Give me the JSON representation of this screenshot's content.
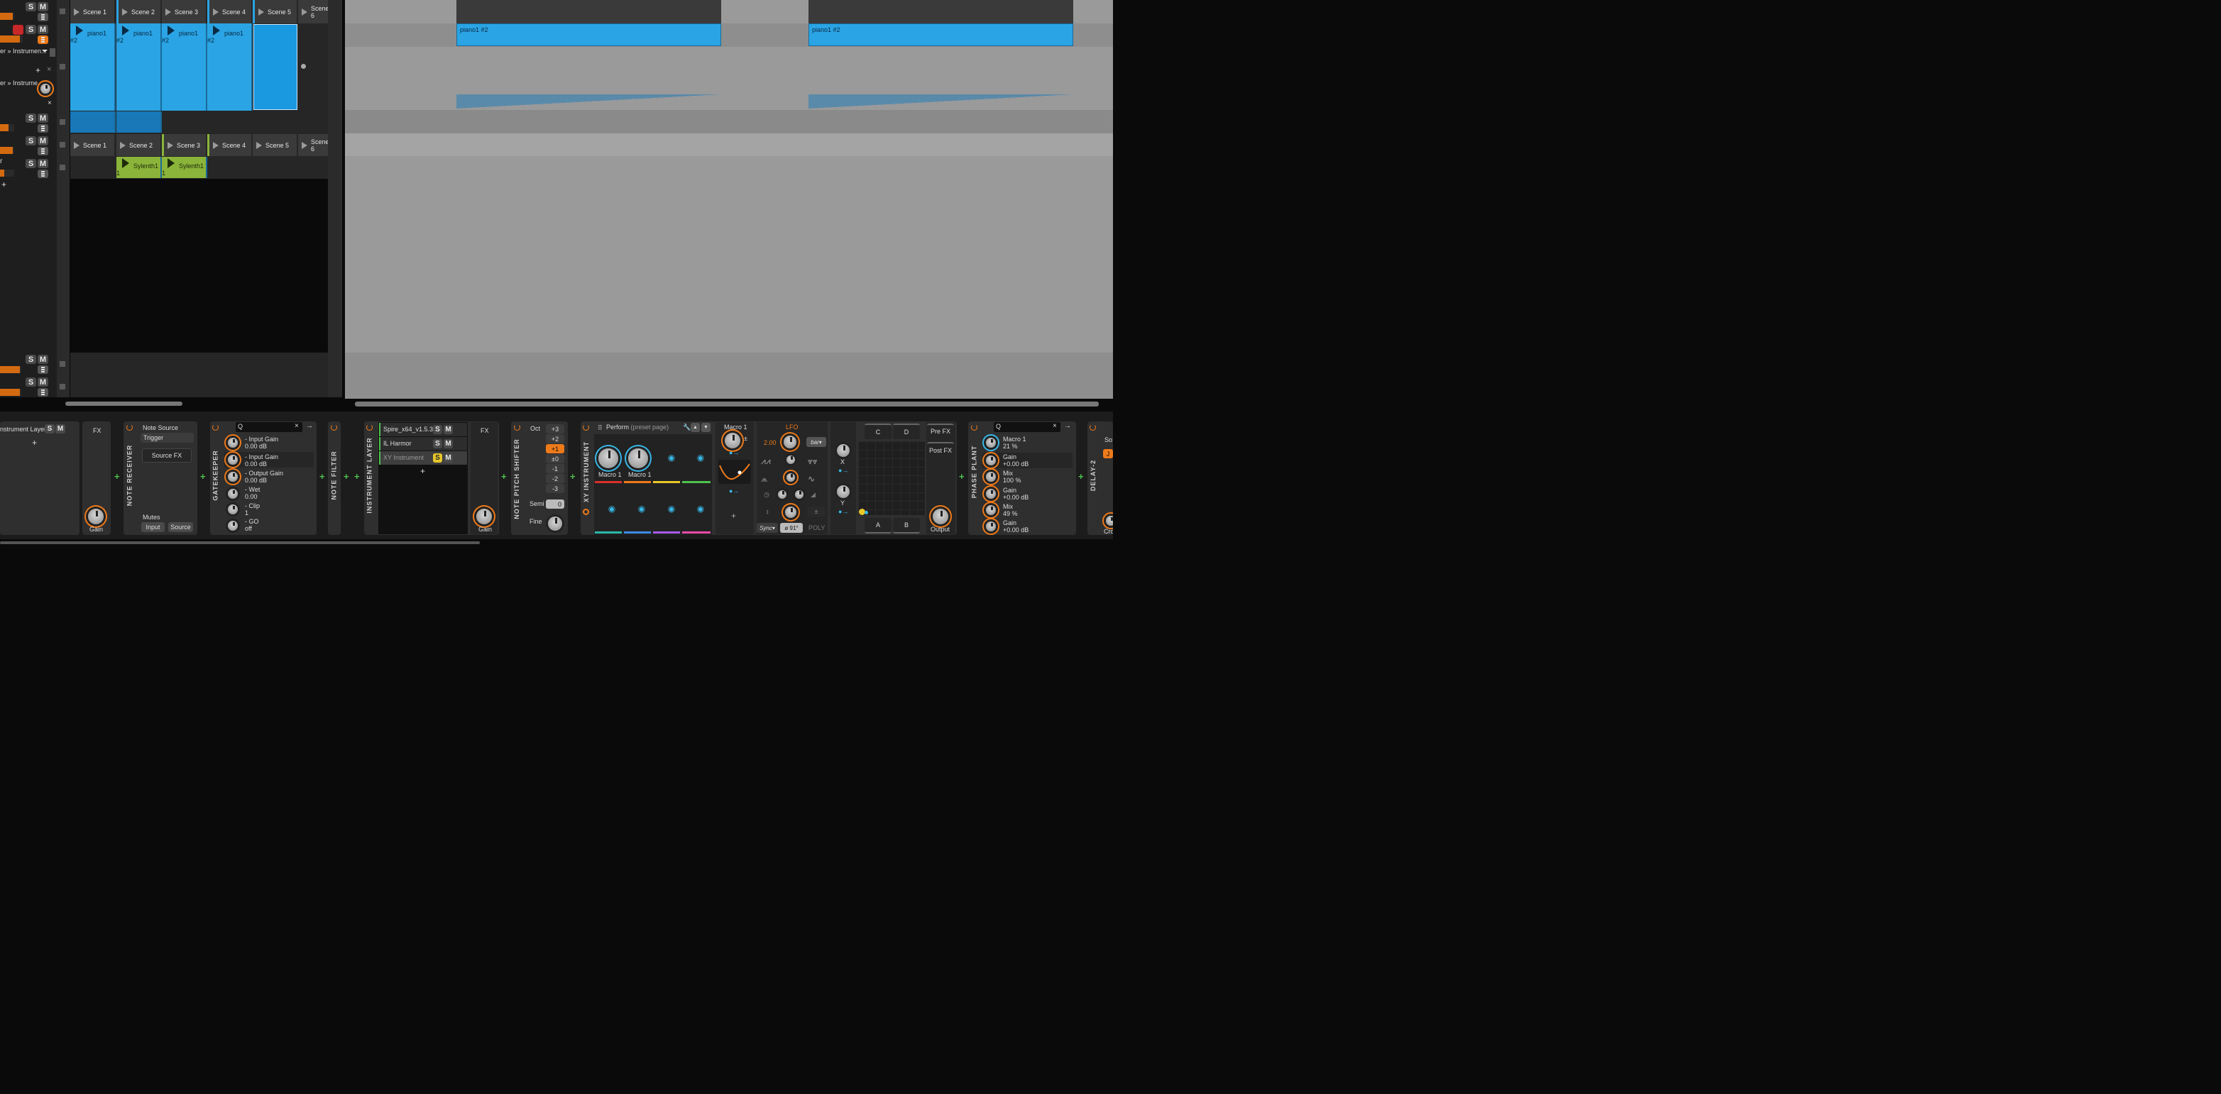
{
  "mixer": {
    "solo": "S",
    "mute": "M"
  },
  "tracks": [
    {
      "scenes": [
        "Scene 1",
        "Scene 2",
        "Scene 3",
        "Scene 4",
        "Scene 5",
        "Scene 6"
      ]
    },
    {
      "device_label_1": "er » Instrumen...",
      "device_label_2": "er » Instrume...",
      "clips": [
        "piano1 #2",
        "piano1 #2",
        "piano1 #2",
        "piano1 #2"
      ]
    },
    {
      "scenes2": [
        "Scene 1",
        "Scene 2",
        "Scene 3",
        "Scene 4",
        "Scene 5",
        "Scene 6"
      ]
    },
    {
      "clips": [
        "Sylenth1 1",
        "Sylenth1 1"
      ],
      "name": "r"
    }
  ],
  "arranger": {
    "clip_a": "piano1 #2",
    "clip_b": "piano1 #2"
  },
  "devices": {
    "instrument_layer_left": {
      "label": "nstrument Layer",
      "fx": "FX",
      "gain": "Gain"
    },
    "note_receiver": {
      "title": "NOTE RECEIVER",
      "note_source": "Note Source",
      "trigger": "Trigger",
      "source_fx": "Source FX",
      "mutes": "Mutes",
      "input": "Input",
      "source": "Source"
    },
    "gatekeeper": {
      "title": "GATEKEEPER",
      "params": [
        {
          "name": "- Input Gain",
          "value": "0.00 dB"
        },
        {
          "name": "- Input Gain",
          "value": "0.00 dB"
        },
        {
          "name": "- Output Gain",
          "value": "0.00 dB"
        },
        {
          "name": "- Wet",
          "value": "0.00"
        },
        {
          "name": "- Clip",
          "value": "1"
        },
        {
          "name": "- GO",
          "value": "off"
        }
      ]
    },
    "note_filter": {
      "title": "NOTE FILTER"
    },
    "instrument_layer": {
      "title": "INSTRUMENT LAYER",
      "layers": [
        "Spire_x64_v1.5.3",
        "IL Harmor",
        "XY Instrument"
      ],
      "fx": "FX",
      "gain": "Gain"
    },
    "note_pitch_shifter": {
      "title": "NOTE PITCH SHIFTER",
      "oct": "Oct",
      "values": [
        "+3",
        "+2",
        "+1",
        "±0",
        "-1",
        "-2",
        "-3"
      ],
      "semi": "Semi",
      "semi_value": "0",
      "fine": "Fine"
    },
    "xy_instrument": {
      "title": "XY INSTRUMENT",
      "perform": "Perform",
      "preset_page": "(preset page)",
      "macro": "Macro 1",
      "macro2": "Macro 1",
      "macro_panel": "Macro 1",
      "lfo": "LFO",
      "lfo_rate": "2.00",
      "bar": "bar",
      "sync": "Sync",
      "phase": "ø 91°",
      "poly": "POLY",
      "x": "X",
      "y": "Y",
      "c": "C",
      "d": "D",
      "a": "A",
      "b": "B",
      "pre_fx": "Pre FX",
      "post_fx": "Post FX",
      "output": "Output"
    },
    "phase_plant": {
      "title": "PHASE PLANT",
      "params": [
        {
          "name": "Macro 1",
          "value": "21 %"
        },
        {
          "name": "Gain",
          "value": "+0.00 dB"
        },
        {
          "name": "Mix",
          "value": "100 %"
        },
        {
          "name": "Gain",
          "value": "+0.00 dB"
        },
        {
          "name": "Mix",
          "value": "49 %"
        },
        {
          "name": "Gain",
          "value": "+0.00 dB"
        }
      ]
    },
    "delay2": {
      "title": "DELAY-2",
      "so": "So",
      "cro": "Cro",
      "j": "J"
    }
  },
  "colors": {
    "clip_blue": "#2aa4e4",
    "clip_green": "#8ab43a",
    "accent": "#ee7a1a",
    "bg_dark": "#1c1c1c"
  }
}
